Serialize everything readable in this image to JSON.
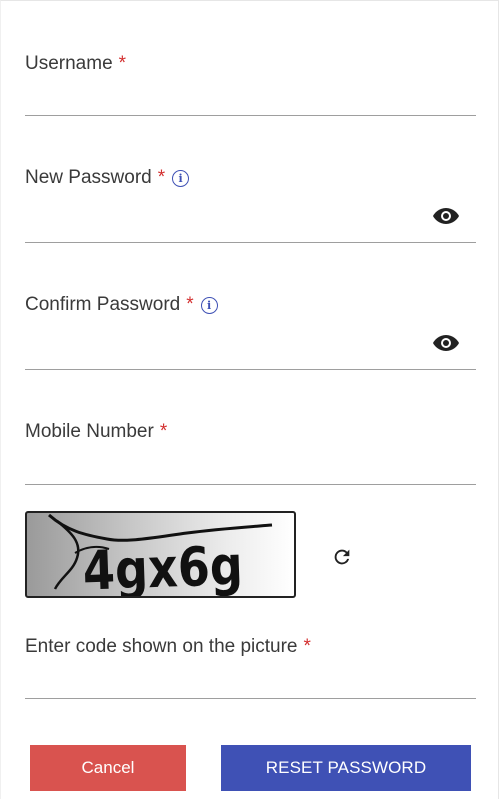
{
  "form": {
    "username": {
      "label": "Username",
      "required_mark": "*",
      "value": ""
    },
    "new_password": {
      "label": "New Password",
      "required_mark": "*",
      "info_icon": "info-icon",
      "toggle_icon": "eye-icon",
      "value": ""
    },
    "confirm_password": {
      "label": "Confirm Password",
      "required_mark": "*",
      "info_icon": "info-icon",
      "toggle_icon": "eye-icon",
      "value": ""
    },
    "mobile_number": {
      "label": "Mobile Number",
      "required_mark": "*",
      "value": ""
    },
    "captcha": {
      "code_text": "4gx6g",
      "refresh_icon": "refresh-icon"
    },
    "captcha_input": {
      "label": "Enter code shown on the picture",
      "required_mark": "*",
      "value": ""
    }
  },
  "actions": {
    "cancel_label": "Cancel",
    "reset_label": "RESET PASSWORD"
  },
  "colors": {
    "required": "#d32f2f",
    "info": "#3f51b5",
    "cancel_button": "#d9534f",
    "reset_button": "#3f51b5"
  }
}
